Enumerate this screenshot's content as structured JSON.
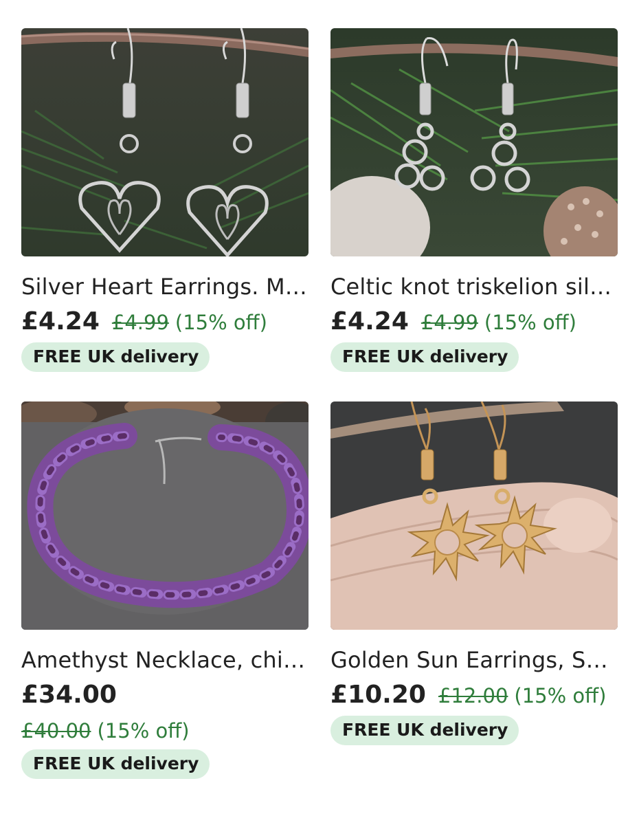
{
  "listings": [
    {
      "title": "Silver Heart Earrings. M…",
      "price": "£4.24",
      "original_price": "£4.99",
      "discount": "(15% off)",
      "badge": "FREE UK delivery"
    },
    {
      "title": "Celtic knot triskelion silv…",
      "price": "£4.24",
      "original_price": "£4.99",
      "discount": "(15% off)",
      "badge": "FREE UK delivery"
    },
    {
      "title": "Amethyst Necklace, chi…",
      "price": "£34.00",
      "original_price": "£40.00",
      "discount": "(15% off)",
      "badge": "FREE UK delivery"
    },
    {
      "title": "Golden Sun Earrings, So…",
      "price": "£10.20",
      "original_price": "£12.00",
      "discount": "(15% off)",
      "badge": "FREE UK delivery"
    }
  ],
  "colors": {
    "discount_green": "#2f7d3b",
    "badge_bg": "#d9efdf",
    "text": "#222222"
  }
}
